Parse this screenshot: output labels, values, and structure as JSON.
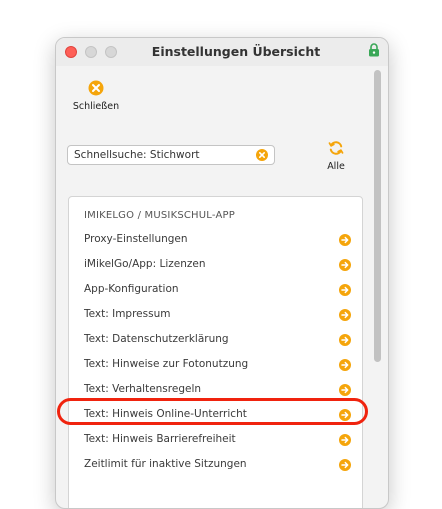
{
  "window": {
    "title": "Einstellungen Übersicht"
  },
  "toolbar": {
    "close_label": "Schließen",
    "close_icon": "close-circle-icon",
    "refresh_label": "Alle",
    "refresh_icon": "refresh-icon"
  },
  "search": {
    "value": "Schnellsuche: Stichwort"
  },
  "list": {
    "section_title": "IMIKELGO / MUSIKSCHUL-APP",
    "items": [
      {
        "label": "Proxy-Einstellungen"
      },
      {
        "label": "iMikelGo/App: Lizenzen"
      },
      {
        "label": "App-Konfiguration"
      },
      {
        "label": "Text: Impressum"
      },
      {
        "label": "Text: Datenschutzerklärung"
      },
      {
        "label": "Text: Hinweise zur Fotonutzung"
      },
      {
        "label": "Text: Verhaltensregeln"
      },
      {
        "label": "Text: Hinweis Online-Unterricht",
        "highlighted": true
      },
      {
        "label": "Text: Hinweis Barrierefreiheit"
      },
      {
        "label": "Zeitlimit für inaktive Sitzungen"
      }
    ]
  },
  "colors": {
    "accent": "#f5a50b",
    "highlight": "#f0230e",
    "close_button": "#fe5f57"
  }
}
